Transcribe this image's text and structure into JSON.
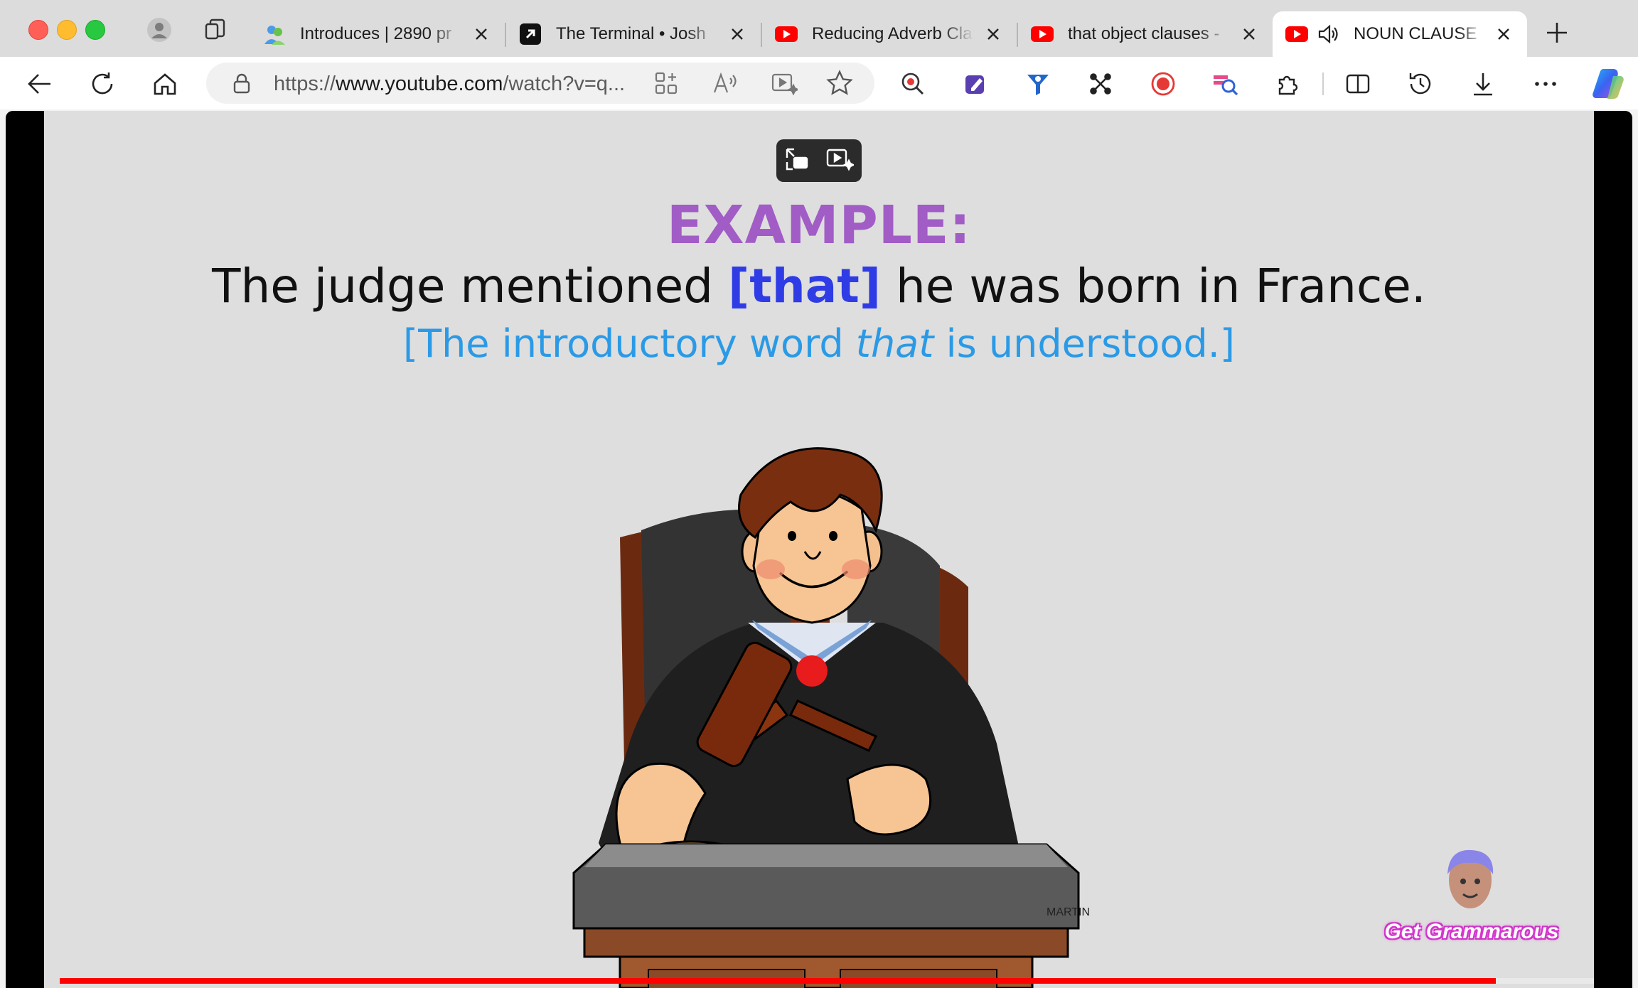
{
  "browser": {
    "tabs": [
      {
        "title": "Introduces | 2890 pr",
        "favicon": "people-icon",
        "active": false
      },
      {
        "title": "The Terminal • Josh",
        "favicon": "arrow-icon",
        "active": false
      },
      {
        "title": "Reducing Adverb Cla",
        "favicon": "youtube-icon",
        "active": false
      },
      {
        "title": "that object clauses -",
        "favicon": "youtube-icon",
        "active": false
      },
      {
        "title": "NOUN CLAUSE",
        "favicon": "youtube-icon",
        "active": true,
        "audio": true
      }
    ],
    "address": {
      "scheme": "https://",
      "host": "www.youtube.com",
      "path": "/watch?v=q..."
    }
  },
  "video": {
    "example_label": "EXAMPLE:",
    "sentence": {
      "before": "The judge mentioned ",
      "highlight": "[that]",
      "after": " he was born in France."
    },
    "note": {
      "before": "[The introductory word ",
      "italic": "that",
      "after": " is understood.]"
    },
    "artist_credit": "MARTIN",
    "brand": "Get Grammarous",
    "progress": 0.9
  },
  "colors": {
    "example": "#a15cc6",
    "highlight": "#2f3ce6",
    "note": "#2b9ae6",
    "progress": "#ff0000",
    "youtube": "#ff0000"
  }
}
